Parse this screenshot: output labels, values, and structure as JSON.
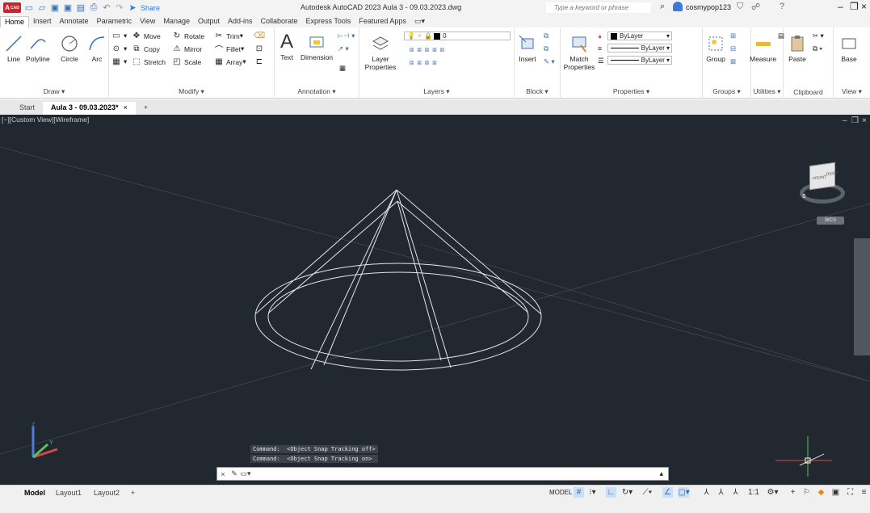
{
  "app": {
    "logo": "A",
    "logo_sub": "CAD",
    "title": "Autodesk AutoCAD 2023   Aula 3 - 09.03.2023.dwg",
    "share_label": "Share",
    "search_placeholder": "Type a keyword or phrase",
    "user_name": "cosmypop123",
    "qat_icons": [
      "new-icon",
      "open-icon",
      "save-icon",
      "save-as-icon",
      "web-mobile-icon",
      "print-icon",
      "undo-icon",
      "redo-icon",
      "share-icon"
    ]
  },
  "ribbon_tabs": [
    "Home",
    "Insert",
    "Annotate",
    "Parametric",
    "View",
    "Manage",
    "Output",
    "Add-ins",
    "Collaborate",
    "Express Tools",
    "Featured Apps"
  ],
  "ribbon": {
    "draw": {
      "title": "Draw ▾",
      "line": "Line",
      "polyline": "Polyline",
      "circle": "Circle",
      "arc": "Arc"
    },
    "modify": {
      "title": "Modify ▾",
      "move": "Move",
      "rotate": "Rotate",
      "trim": "Trim",
      "copy": "Copy",
      "mirror": "Mirror",
      "fillet": "Fillet",
      "stretch": "Stretch",
      "scale": "Scale",
      "array": "Array"
    },
    "annotation": {
      "title": "Annotation ▾",
      "text": "Text",
      "dimension": "Dimension"
    },
    "layers": {
      "title": "Layers ▾",
      "layer_properties": "Layer Properties",
      "current_layer": "0"
    },
    "block": {
      "title": "Block ▾",
      "insert": "Insert"
    },
    "properties": {
      "title": "Properties ▾",
      "match": "Match Properties",
      "color": "ByLayer",
      "linetype": "ByLayer",
      "lineweight": "ByLayer"
    },
    "groups": {
      "title": "Groups ▾",
      "group": "Group"
    },
    "utilities": {
      "title": "Utilities ▾",
      "measure": "Measure"
    },
    "clipboard": {
      "title": "Clipboard",
      "paste": "Paste"
    },
    "view": {
      "title": "View ▾",
      "base": "Base"
    }
  },
  "file_tabs": {
    "start": "Start",
    "active": "Aula 3 - 09.03.2023*",
    "close": "×",
    "add": "+"
  },
  "viewport": {
    "label": "[−][Custom View][Wireframe]",
    "viewcube_right": "RIGHT",
    "viewcube_front": "FRONT",
    "compass_s": "S",
    "wcs": "WCS",
    "ucs_x": "X",
    "ucs_y": "Y",
    "ucs_z": "Z"
  },
  "command": {
    "history": [
      "Command:  <Object Snap Tracking off>",
      "Command:  <Object Snap Tracking on>"
    ],
    "input_value": "",
    "close_glyph": "×"
  },
  "layout_tabs": [
    "Model",
    "Layout1",
    "Layout2",
    "+"
  ],
  "status": {
    "model_label": "MODEL",
    "scale": "1:1"
  },
  "colors": {
    "viewport_bg": "#212830",
    "wire": "#e6e6e6",
    "accent": "#1f6fc5",
    "brand": "#c8262e"
  }
}
